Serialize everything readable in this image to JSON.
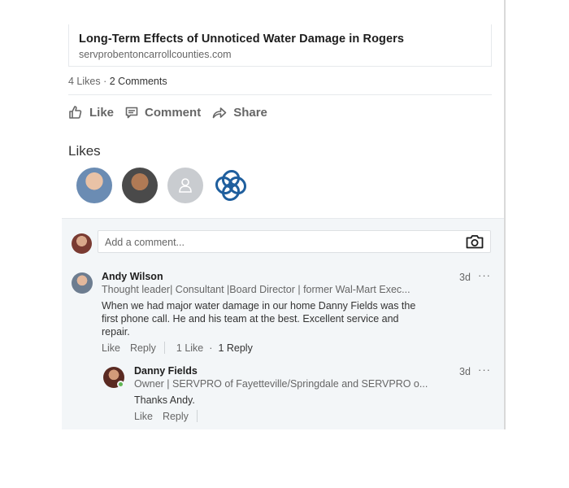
{
  "post": {
    "link_title": "Long-Term Effects of Unnoticed Water Damage in Rogers",
    "link_domain": "servprobentoncarrollcounties.com",
    "likes_count": "4 Likes",
    "separator": "·",
    "comments_count": "2 Comments"
  },
  "actions": {
    "like": "Like",
    "comment": "Comment",
    "share": "Share"
  },
  "likes_section": {
    "heading": "Likes",
    "likers": [
      "person-photo",
      "person-photo",
      "placeholder-avatar",
      "company-logo"
    ]
  },
  "comment_box": {
    "placeholder": "Add a comment..."
  },
  "comments": [
    {
      "name": "Andy Wilson",
      "headline": "Thought leader| Consultant |Board Director | former Wal-Mart Exec...",
      "time": "3d",
      "text": "When we had major water damage in our home Danny Fields was the first phone call. He and his team at the best.  Excellent service and repair.",
      "like_label": "Like",
      "reply_label": "Reply",
      "likes": "1 Like",
      "dot": "·",
      "replies": "1 Reply"
    }
  ],
  "reply": {
    "name": "Danny Fields",
    "headline": "Owner | SERVPRO of Fayetteville/Springdale and SERVPRO o...",
    "time": "3d",
    "text": "Thanks Andy.",
    "like_label": "Like",
    "reply_label": "Reply"
  },
  "menu_glyph": "···",
  "colors": {
    "logo_blue": "#1f5f9e",
    "online_green": "#5fb653",
    "comment_bg": "#f3f6f8"
  }
}
